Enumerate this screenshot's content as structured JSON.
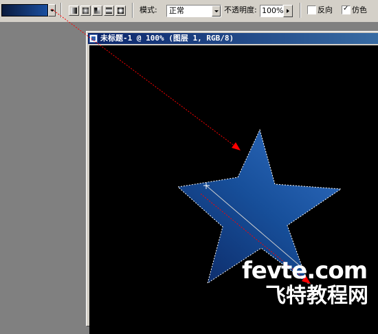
{
  "toolbar": {
    "mode_label": "模式:",
    "mode_value": "正常",
    "opacity_label": "不透明度:",
    "opacity_value": "100%",
    "reverse_label": "反向",
    "reverse_checked": false,
    "dither_label": "仿色",
    "dither_checked": true,
    "gradient_types": [
      "linear-gradient-icon",
      "radial-gradient-icon",
      "angle-gradient-icon",
      "reflected-gradient-icon",
      "diamond-gradient-icon"
    ]
  },
  "document": {
    "title": "未标题-1 @ 100% (图层 1, RGB/8)"
  },
  "colors": {
    "gradient_start": "#0a1a3c",
    "gradient_end": "#1a4fa0",
    "title_bar": "#0a246a",
    "annotation_arrow": "#ff0000"
  },
  "watermark": {
    "line1": "fevte.com",
    "line2": "飞特教程网"
  }
}
